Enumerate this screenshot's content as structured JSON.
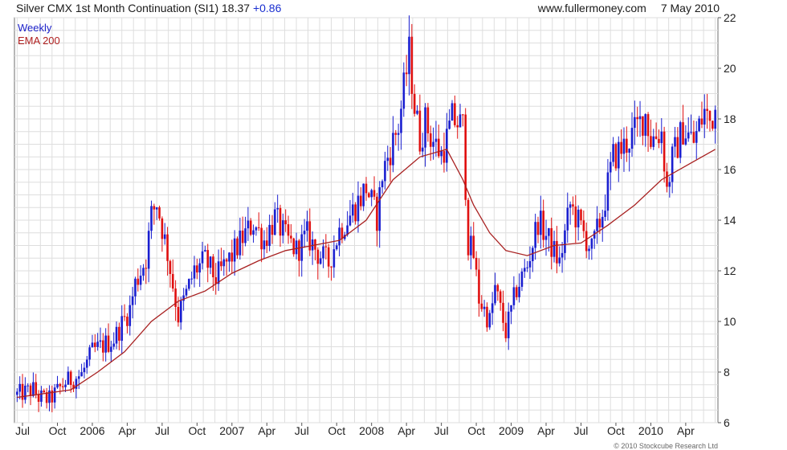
{
  "header": {
    "title": "Silver CMX 1st Month Continuation (SI1)",
    "last_price": "18.37",
    "change": "+0.86",
    "source": "www.fullermoney.com",
    "date": "7 May 2010"
  },
  "legend": {
    "series1": "Weekly",
    "series2": "EMA 200"
  },
  "footer": {
    "copyright": "© 2010 Stockcube Research Ltd"
  },
  "colors": {
    "up": "#1a1fd0",
    "down": "#e01010",
    "ema": "#a82020",
    "grid": "#dedede"
  },
  "chart_data": {
    "type": "line",
    "ylim": [
      6,
      22
    ],
    "y_ticks": [
      6,
      8,
      10,
      12,
      14,
      16,
      18,
      20,
      22
    ],
    "x_ticks": [
      "Jul",
      "Oct",
      "2006",
      "Apr",
      "Jul",
      "Oct",
      "2007",
      "Apr",
      "Jul",
      "Oct",
      "2008",
      "Apr",
      "Jul",
      "Oct",
      "2009",
      "Apr",
      "Jul",
      "Oct",
      "2010",
      "Apr"
    ],
    "x_tick_weeks": [
      2,
      15,
      28,
      41,
      54,
      67,
      80,
      93,
      106,
      119,
      132,
      145,
      158,
      171,
      184,
      197,
      210,
      223,
      236,
      249
    ],
    "x_range_weeks": [
      -1,
      261
    ],
    "grid": true,
    "series": [
      {
        "name": "Weekly",
        "style": "price bars (blue = up week, red = down week)",
        "weeks": [
          0,
          6,
          8,
          12,
          18,
          24,
          28,
          36,
          42,
          44,
          48,
          50,
          52,
          56,
          60,
          66,
          70,
          74,
          80,
          84,
          88,
          92,
          96,
          100,
          104,
          108,
          112,
          116,
          120,
          124,
          128,
          130,
          134,
          136,
          138,
          142,
          146,
          148,
          150,
          152,
          154,
          158,
          160,
          162,
          166,
          168,
          170,
          172,
          176,
          178,
          182,
          184,
          186,
          190,
          194,
          198,
          202,
          206,
          210,
          214,
          218,
          222,
          226,
          230,
          234,
          236,
          240,
          242,
          244,
          248,
          252,
          256,
          258,
          260
        ],
        "close": [
          7.1,
          7.3,
          7.0,
          6.9,
          7.6,
          7.9,
          8.8,
          9.3,
          10.5,
          11.5,
          12.5,
          14.2,
          14.7,
          12.7,
          10.2,
          12.0,
          12.4,
          11.7,
          12.6,
          13.3,
          13.9,
          13.2,
          14.1,
          13.3,
          12.8,
          13.4,
          12.7,
          12.3,
          13.6,
          14.2,
          14.9,
          15.3,
          14.1,
          15.8,
          16.5,
          17.7,
          20.6,
          18.5,
          17.2,
          17.9,
          17.3,
          16.6,
          17.2,
          18.0,
          17.7,
          13.1,
          12.6,
          10.9,
          10.0,
          11.3,
          9.6,
          10.4,
          11.3,
          12.2,
          14.0,
          13.2,
          12.3,
          14.6,
          13.7,
          12.8,
          14.3,
          16.5,
          16.9,
          17.5,
          18.2,
          17.2,
          17.5,
          15.2,
          16.4,
          17.6,
          17.1,
          18.3,
          17.9,
          18.4
        ]
      },
      {
        "name": "EMA 200",
        "weeks": [
          0,
          20,
          30,
          40,
          50,
          60,
          70,
          80,
          90,
          100,
          110,
          120,
          130,
          140,
          150,
          160,
          166,
          170,
          176,
          182,
          190,
          200,
          210,
          220,
          230,
          240,
          250,
          260
        ],
        "values": [
          7.0,
          7.3,
          8.0,
          8.8,
          10.0,
          10.8,
          11.2,
          11.9,
          12.4,
          12.8,
          13.0,
          13.2,
          14.0,
          15.6,
          16.5,
          16.8,
          15.6,
          14.6,
          13.5,
          12.8,
          12.6,
          13.0,
          13.1,
          13.8,
          14.6,
          15.6,
          16.2,
          16.8
        ]
      }
    ]
  }
}
